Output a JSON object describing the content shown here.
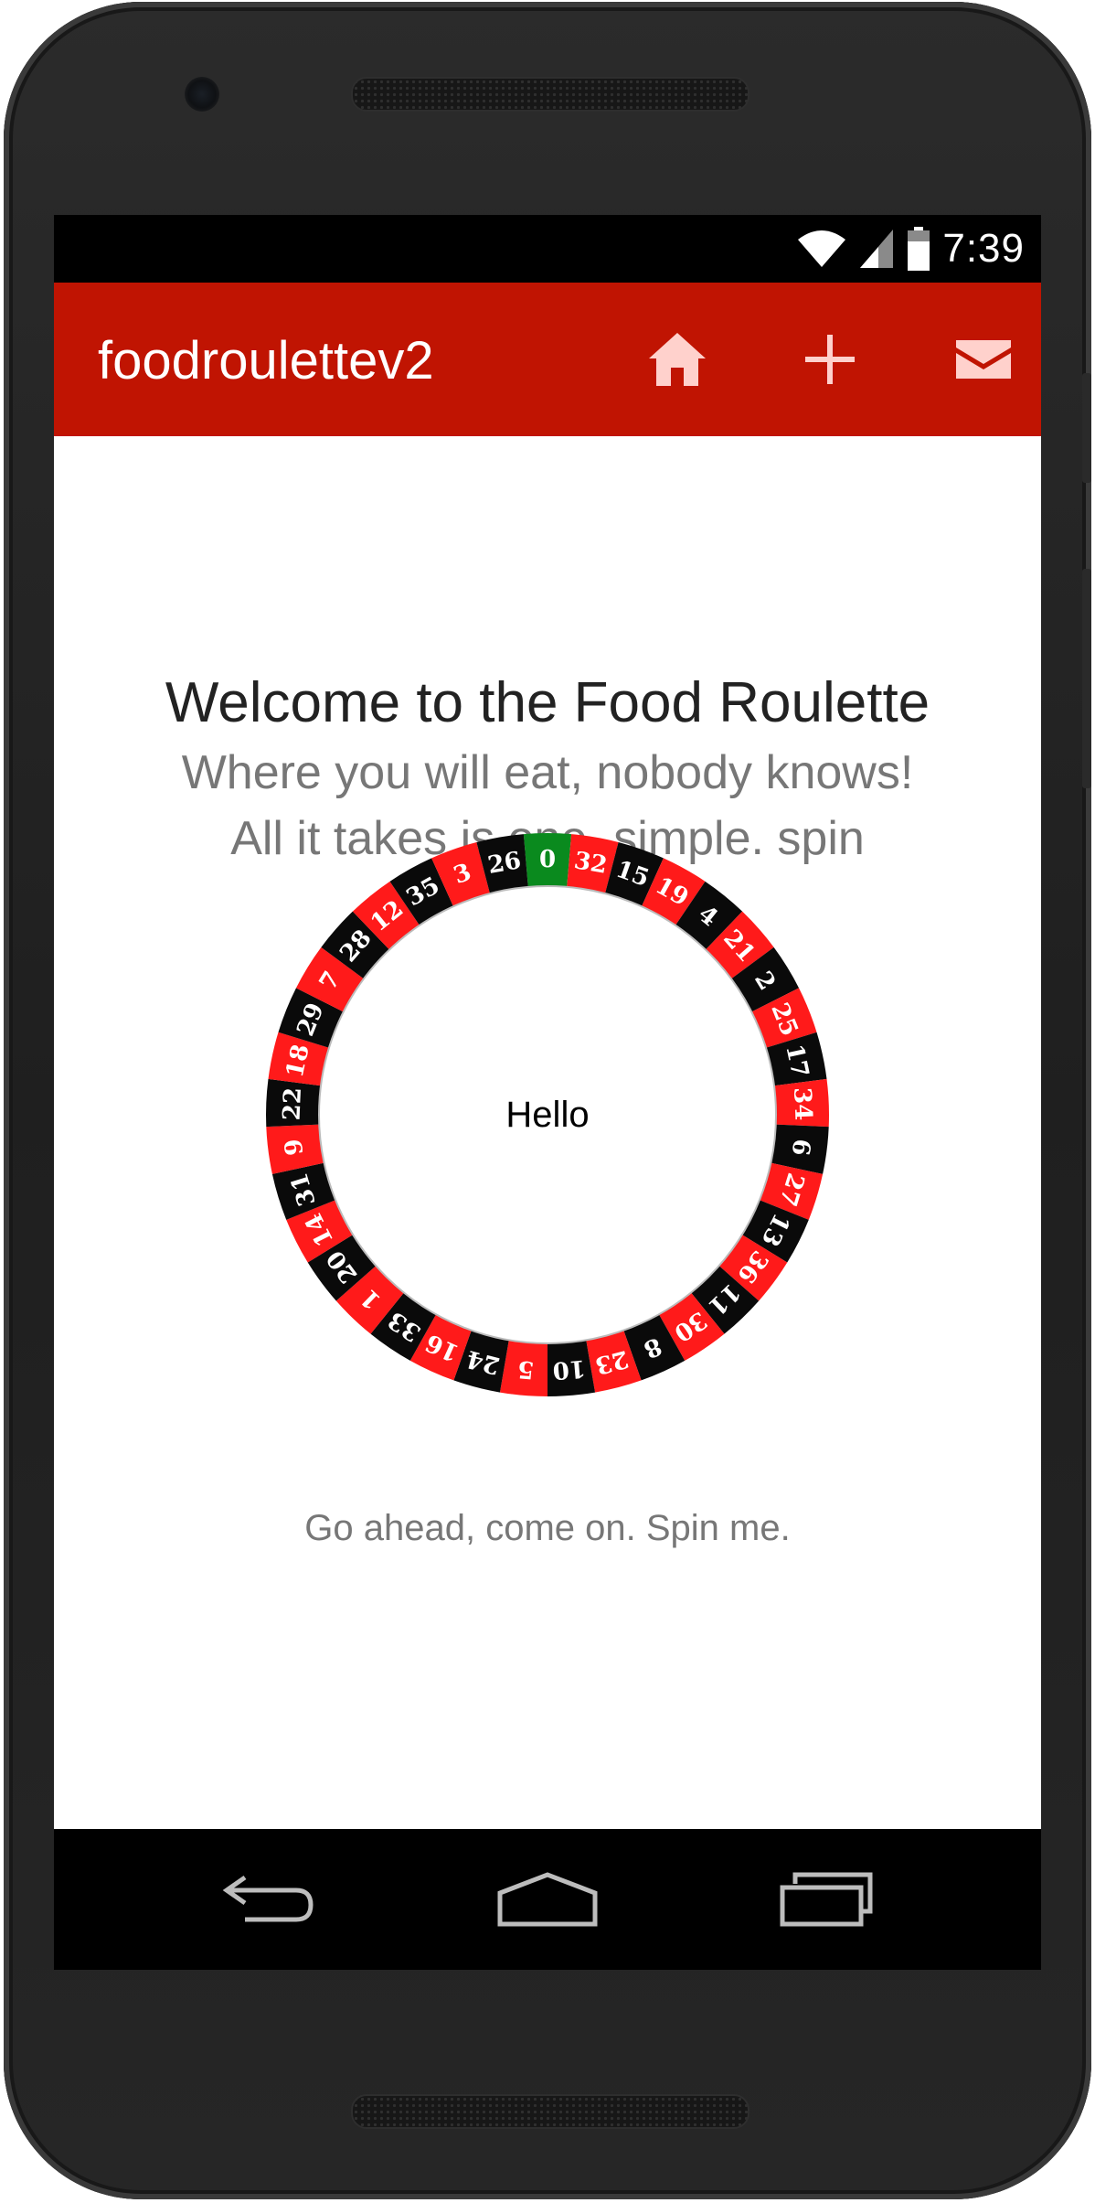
{
  "status_bar": {
    "time": "7:39",
    "icons": [
      "wifi-icon",
      "cell-signal-icon",
      "battery-icon"
    ]
  },
  "app_bar": {
    "title": "foodroulettev2",
    "background_color": "#c01402",
    "actions": [
      {
        "name": "home",
        "icon": "home-icon"
      },
      {
        "name": "add",
        "icon": "plus-icon"
      },
      {
        "name": "mail",
        "icon": "mail-icon"
      }
    ]
  },
  "main": {
    "heading": "Welcome to the Food Roulette",
    "subtitle_1": "Where you will eat, nobody knows!",
    "subtitle_2": "All it takes is one. simple. spin",
    "wheel": {
      "center_text": "Hello",
      "numbers": [
        0,
        32,
        15,
        19,
        4,
        21,
        2,
        25,
        17,
        34,
        6,
        27,
        13,
        36,
        11,
        30,
        8,
        23,
        10,
        5,
        24,
        16,
        33,
        1,
        20,
        14,
        31,
        9,
        22,
        18,
        29,
        7,
        28,
        12,
        35,
        3,
        26
      ],
      "colors": {
        "zero": "#0a8a1e",
        "red": "#ff1a1a",
        "black": "#0a0a0a"
      }
    },
    "spin_hint": "Go ahead, come on. Spin me."
  },
  "nav_bar": {
    "buttons": [
      {
        "name": "back",
        "icon": "back-icon"
      },
      {
        "name": "home",
        "icon": "home-outline-icon"
      },
      {
        "name": "recent",
        "icon": "recent-apps-icon"
      }
    ]
  }
}
